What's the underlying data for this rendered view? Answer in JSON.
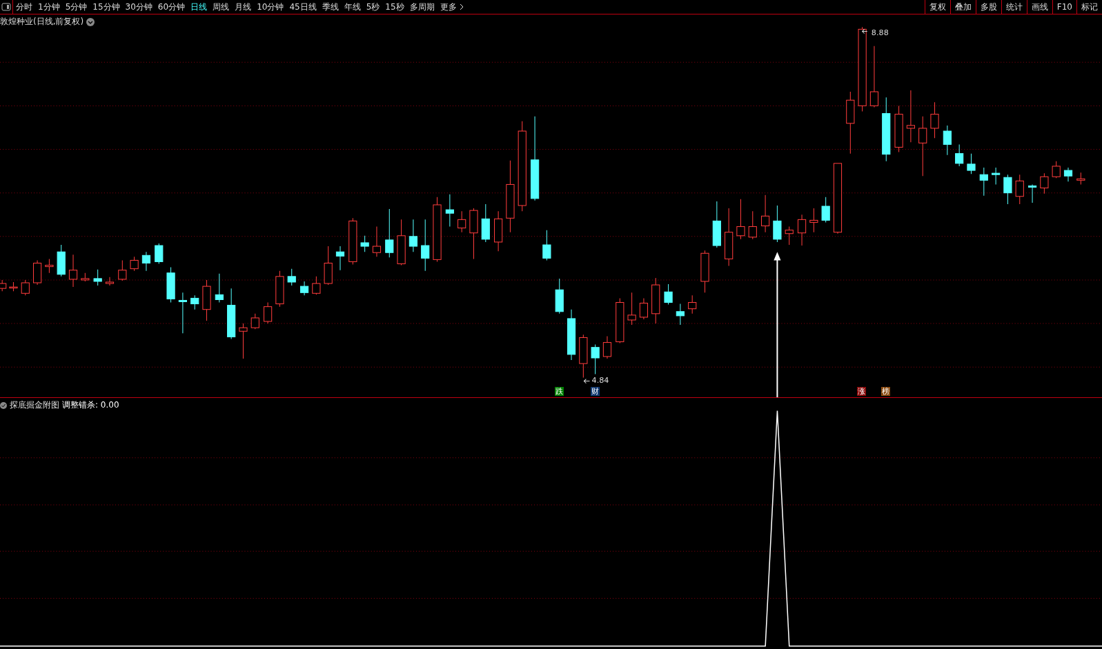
{
  "toolbar": {
    "periods": [
      {
        "label": "分时",
        "selected": false
      },
      {
        "label": "1分钟",
        "selected": false
      },
      {
        "label": "5分钟",
        "selected": false
      },
      {
        "label": "15分钟",
        "selected": false
      },
      {
        "label": "30分钟",
        "selected": false
      },
      {
        "label": "60分钟",
        "selected": false
      },
      {
        "label": "日线",
        "selected": true
      },
      {
        "label": "周线",
        "selected": false
      },
      {
        "label": "月线",
        "selected": false
      },
      {
        "label": "10分钟",
        "selected": false
      },
      {
        "label": "45日线",
        "selected": false
      },
      {
        "label": "季线",
        "selected": false
      },
      {
        "label": "年线",
        "selected": false
      },
      {
        "label": "5秒",
        "selected": false
      },
      {
        "label": "15秒",
        "selected": false
      },
      {
        "label": "多周期",
        "selected": false
      }
    ],
    "more": "更多",
    "tools": [
      "复权",
      "叠加",
      "多股",
      "统计",
      "画线",
      "F10",
      "标记"
    ]
  },
  "main_chart": {
    "title": "敦煌种业(日线,前复权)",
    "high_label": "8.88",
    "low_label": "4.84",
    "signals": [
      {
        "text": "跌",
        "color": "#008000"
      },
      {
        "text": "财",
        "color": "#103870"
      },
      {
        "text": "涨",
        "color": "#8b0a0a"
      },
      {
        "text": "榜",
        "color": "#8a4a10"
      }
    ]
  },
  "sub_chart": {
    "title": "探底掘金附图",
    "series": "调整错杀: 0.00"
  }
}
